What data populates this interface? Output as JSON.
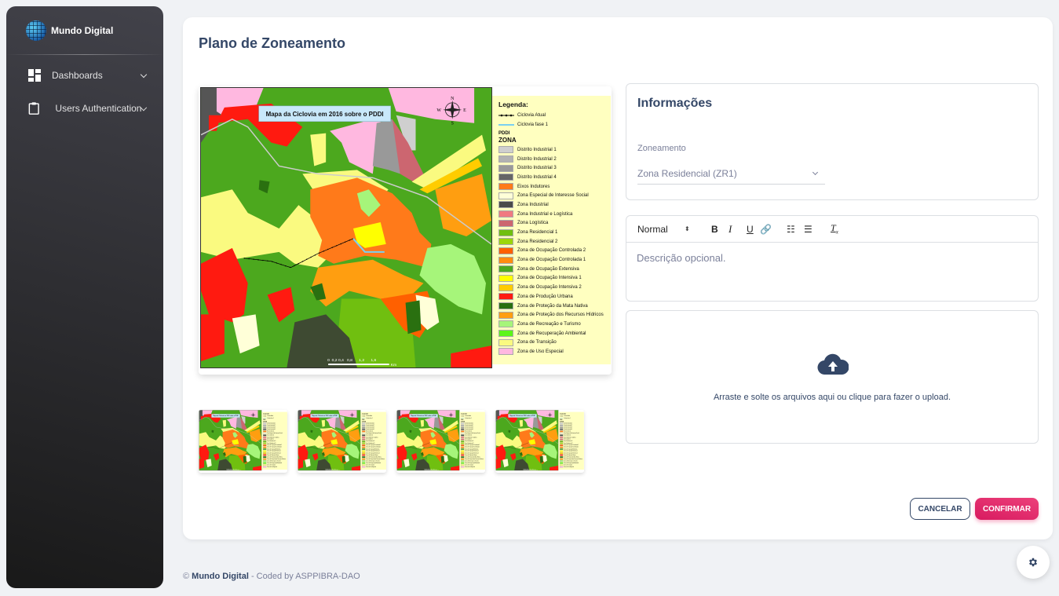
{
  "sidebar": {
    "brand": "Mundo Digital",
    "items": [
      {
        "label": "Dashboards",
        "icon": "dashboard-icon"
      },
      {
        "label": "Users Authentication",
        "icon": "clipboard-icon"
      }
    ]
  },
  "main": {
    "title": "Plano de Zoneamento"
  },
  "map": {
    "title": "Mapa da Ciclovia em 2016 sobre o PDDI",
    "compass": [
      "N",
      "S",
      "E",
      "W"
    ],
    "scale_labels": "0  0,2 0,4   0,8      1,2      1,6",
    "scale_unit": "Km",
    "legend": {
      "title": "Legenda:",
      "lines": [
        {
          "label": "Ciclovia Atual",
          "color": "#000000"
        },
        {
          "label": "Ciclovia fase 1",
          "color": "#7ad0f0"
        }
      ],
      "pddi": "PDDI",
      "zona": "ZONA",
      "items": [
        {
          "label": "Distrito Industrial 1",
          "color": "#cfcfcf"
        },
        {
          "label": "Distrito Industrial 2",
          "color": "#b2b2b2"
        },
        {
          "label": "Distrito Industrial 3",
          "color": "#999999"
        },
        {
          "label": "Distrito Industrial 4",
          "color": "#666666"
        },
        {
          "label": "Eixos Indutores",
          "color": "#ff7a1a"
        },
        {
          "label": "Zona Especial de Interesse Social",
          "color": "#ffffd8"
        },
        {
          "label": "Zona Industrial",
          "color": "#4a4a4a"
        },
        {
          "label": "Zona Industrial e Logística",
          "color": "#f07a80"
        },
        {
          "label": "Zona Logística",
          "color": "#cc6670"
        },
        {
          "label": "Zona Residencial 1",
          "color": "#70bf10"
        },
        {
          "label": "Zona Residencial 2",
          "color": "#9cd60a"
        },
        {
          "label": "Zona de Ocupação Controlada 2",
          "color": "#ff6000"
        },
        {
          "label": "Zona de Ocupação Controlada 1",
          "color": "#ff8c10"
        },
        {
          "label": "Zona de Ocupação Extensiva",
          "color": "#4ca81e"
        },
        {
          "label": "Zona de Ocupação Intensiva 1",
          "color": "#ffff00"
        },
        {
          "label": "Zona de Ocupação Intensiva 2",
          "color": "#ffcc00"
        },
        {
          "label": "Zona de Produção Urbana",
          "color": "#ff1a10"
        },
        {
          "label": "Zona de Proteção da Mata Nativa",
          "color": "#2a7010"
        },
        {
          "label": "Zona de Proteção dos Recursos Hídricos",
          "color": "#ff9e10"
        },
        {
          "label": "Zona de Recreação e Turismo",
          "color": "#a6f57a"
        },
        {
          "label": "Zona de Recuperação Ambiental",
          "color": "#5cf51a"
        },
        {
          "label": "Zona de Transição",
          "color": "#fafa80"
        },
        {
          "label": "Zona de Uso Especial",
          "color": "#ffb8e0"
        }
      ]
    }
  },
  "thumbnails": 4,
  "info": {
    "title": "Informações",
    "field_label": "Zoneamento",
    "field_value": "Zona Residencial (ZR1)"
  },
  "editor": {
    "format": "Normal",
    "placeholder": "Descrição opcional.",
    "tools": [
      "bold",
      "italic",
      "underline",
      "link",
      "ordered-list",
      "bullet-list",
      "clear-format"
    ]
  },
  "upload": {
    "text": "Arraste e solte os arquivos aqui ou clique para fazer o upload."
  },
  "actions": {
    "cancel": "CANCELAR",
    "confirm": "CONFIRMAR"
  },
  "footer": {
    "prefix": "©",
    "brand": "Mundo Digital",
    "suffix": "- Coded by ASPPIBRA-DAO"
  },
  "colors": {
    "accent": "#e91e63",
    "primary_text": "#344767"
  }
}
